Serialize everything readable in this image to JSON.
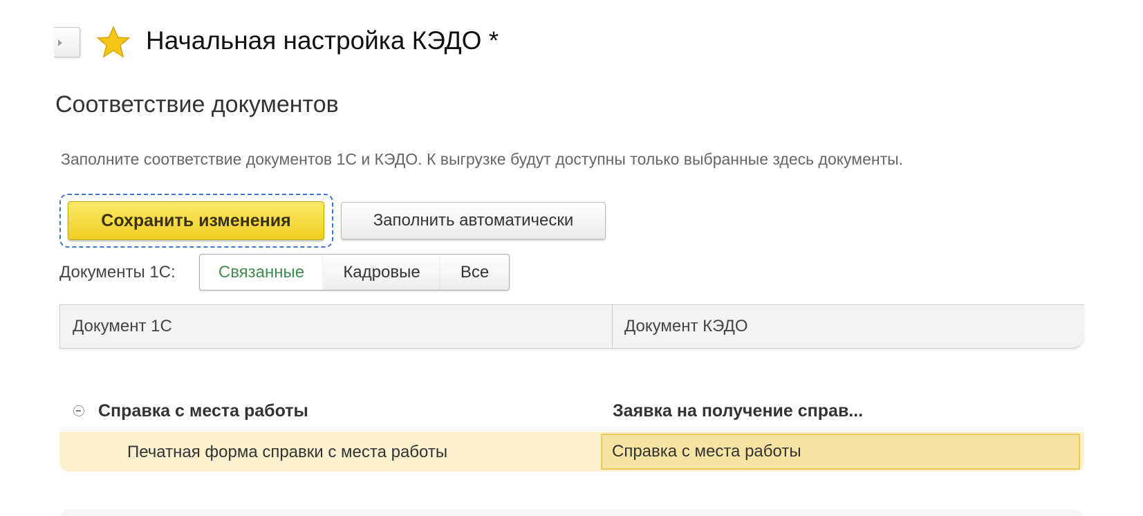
{
  "window": {
    "title": "Начальная настройка КЭДО *",
    "favorite_icon": "star-icon",
    "nav_icon": "chevron-right-icon"
  },
  "section": {
    "title": "Соответствие документов",
    "hint": "Заполните соответствие документов 1С и КЭДО. К выгрузке будут доступны только выбранные здесь документы."
  },
  "toolbar": {
    "save_label": "Сохранить изменения",
    "auto_fill_label": "Заполнить автоматически"
  },
  "filter": {
    "label": "Документы 1С:",
    "options": [
      "Связанные",
      "Кадровые",
      "Все"
    ],
    "selected": "Связанные"
  },
  "table": {
    "columns": [
      "Документ 1С",
      "Документ КЭДО"
    ],
    "groups": [
      {
        "name": "Справка с места работы",
        "kedo": "Заявка на получение справ...",
        "items": [
          {
            "name": "Печатная форма справки с места работы",
            "kedo": "Справка с места работы"
          }
        ]
      }
    ]
  },
  "colors": {
    "accent_yellow": "#f0cf22",
    "selected_row": "#fbf1cf",
    "filter_selected_text": "#3e8d4d",
    "focus_ring": "#3a76d8"
  }
}
